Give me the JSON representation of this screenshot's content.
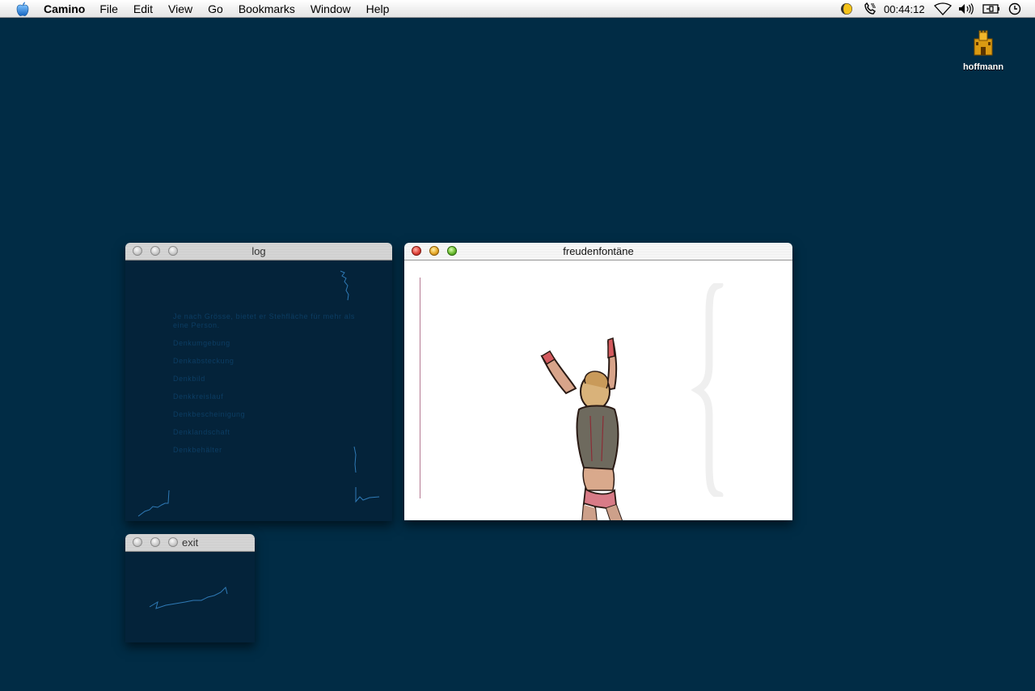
{
  "menubar": {
    "app_name": "Camino",
    "items": [
      "File",
      "Edit",
      "View",
      "Go",
      "Bookmarks",
      "Window",
      "Help"
    ],
    "clock": "00:44:12",
    "status_icons": [
      "moon-icon",
      "phone-icon",
      "wifi-icon",
      "volume-icon",
      "battery-icon",
      "clock-icon"
    ]
  },
  "desktop": {
    "background": "#012c45",
    "icon_label": "hoffmann"
  },
  "windows": {
    "log": {
      "title": "log",
      "intro": "Je nach Grösse, bietet er Stehfläche für mehr als eine Person.",
      "items": [
        "Denkumgebung",
        "Denkabsteckung",
        "Denkbild",
        "Denkkreislauf",
        "Denkbescheinigung",
        "Denklandschaft",
        "Denkbehälter"
      ]
    },
    "freudenfontaene": {
      "title": "freudenfontäne"
    },
    "exit": {
      "title": "exit"
    }
  }
}
